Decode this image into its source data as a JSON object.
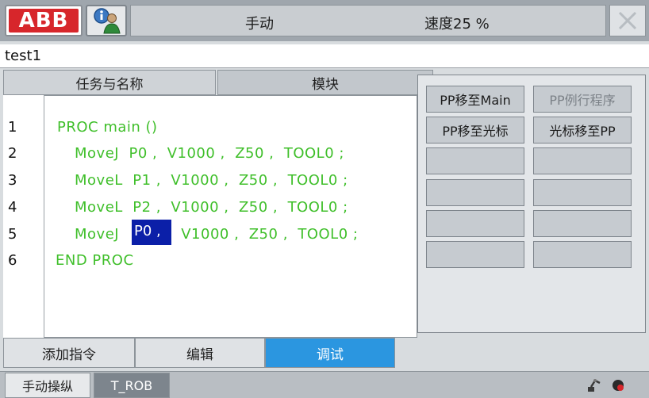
{
  "header": {
    "logo_text": "ABB",
    "mode": "手动",
    "speed": "速度25 %"
  },
  "program": {
    "name": "test1"
  },
  "tabs": [
    {
      "label": "任务与名称"
    },
    {
      "label": "模块"
    }
  ],
  "code": {
    "lines": [
      {
        "num": "1",
        "text": "PROC main ()"
      },
      {
        "num": "2",
        "text": "MoveJ  P0 ,  V1000 ,  Z50 ,  TOOL0 ;"
      },
      {
        "num": "3",
        "text": "MoveL  P1 ,  V1000 ,  Z50 ,  TOOL0 ;"
      },
      {
        "num": "4",
        "text": "MoveL  P2 ,  V1000 ,  Z50 ,  TOOL0 ;"
      },
      {
        "num": "5",
        "pre": "MoveJ ",
        "selected": "P0 ,",
        "post": " V1000 ,  Z50 ,  TOOL0 ;"
      },
      {
        "num": "6",
        "text": "END PROC"
      }
    ]
  },
  "menu": {
    "pp_to_main": "PP移至Main",
    "pp_to_routine": "PP例行程序",
    "pp_to_cursor": "PP移至光标",
    "cursor_to_pp": "光标移至PP"
  },
  "toolbar": {
    "add_instruction": "添加指令",
    "edit": "编辑",
    "debug": "调试"
  },
  "taskbar": {
    "manual_jog": "手动操纵",
    "task_name": "T_ROB"
  },
  "colors": {
    "code_text": "#3fbf2a",
    "selection": "#0b1fa8",
    "active_button": "#2b96e0",
    "logo_red": "#d7262b"
  }
}
